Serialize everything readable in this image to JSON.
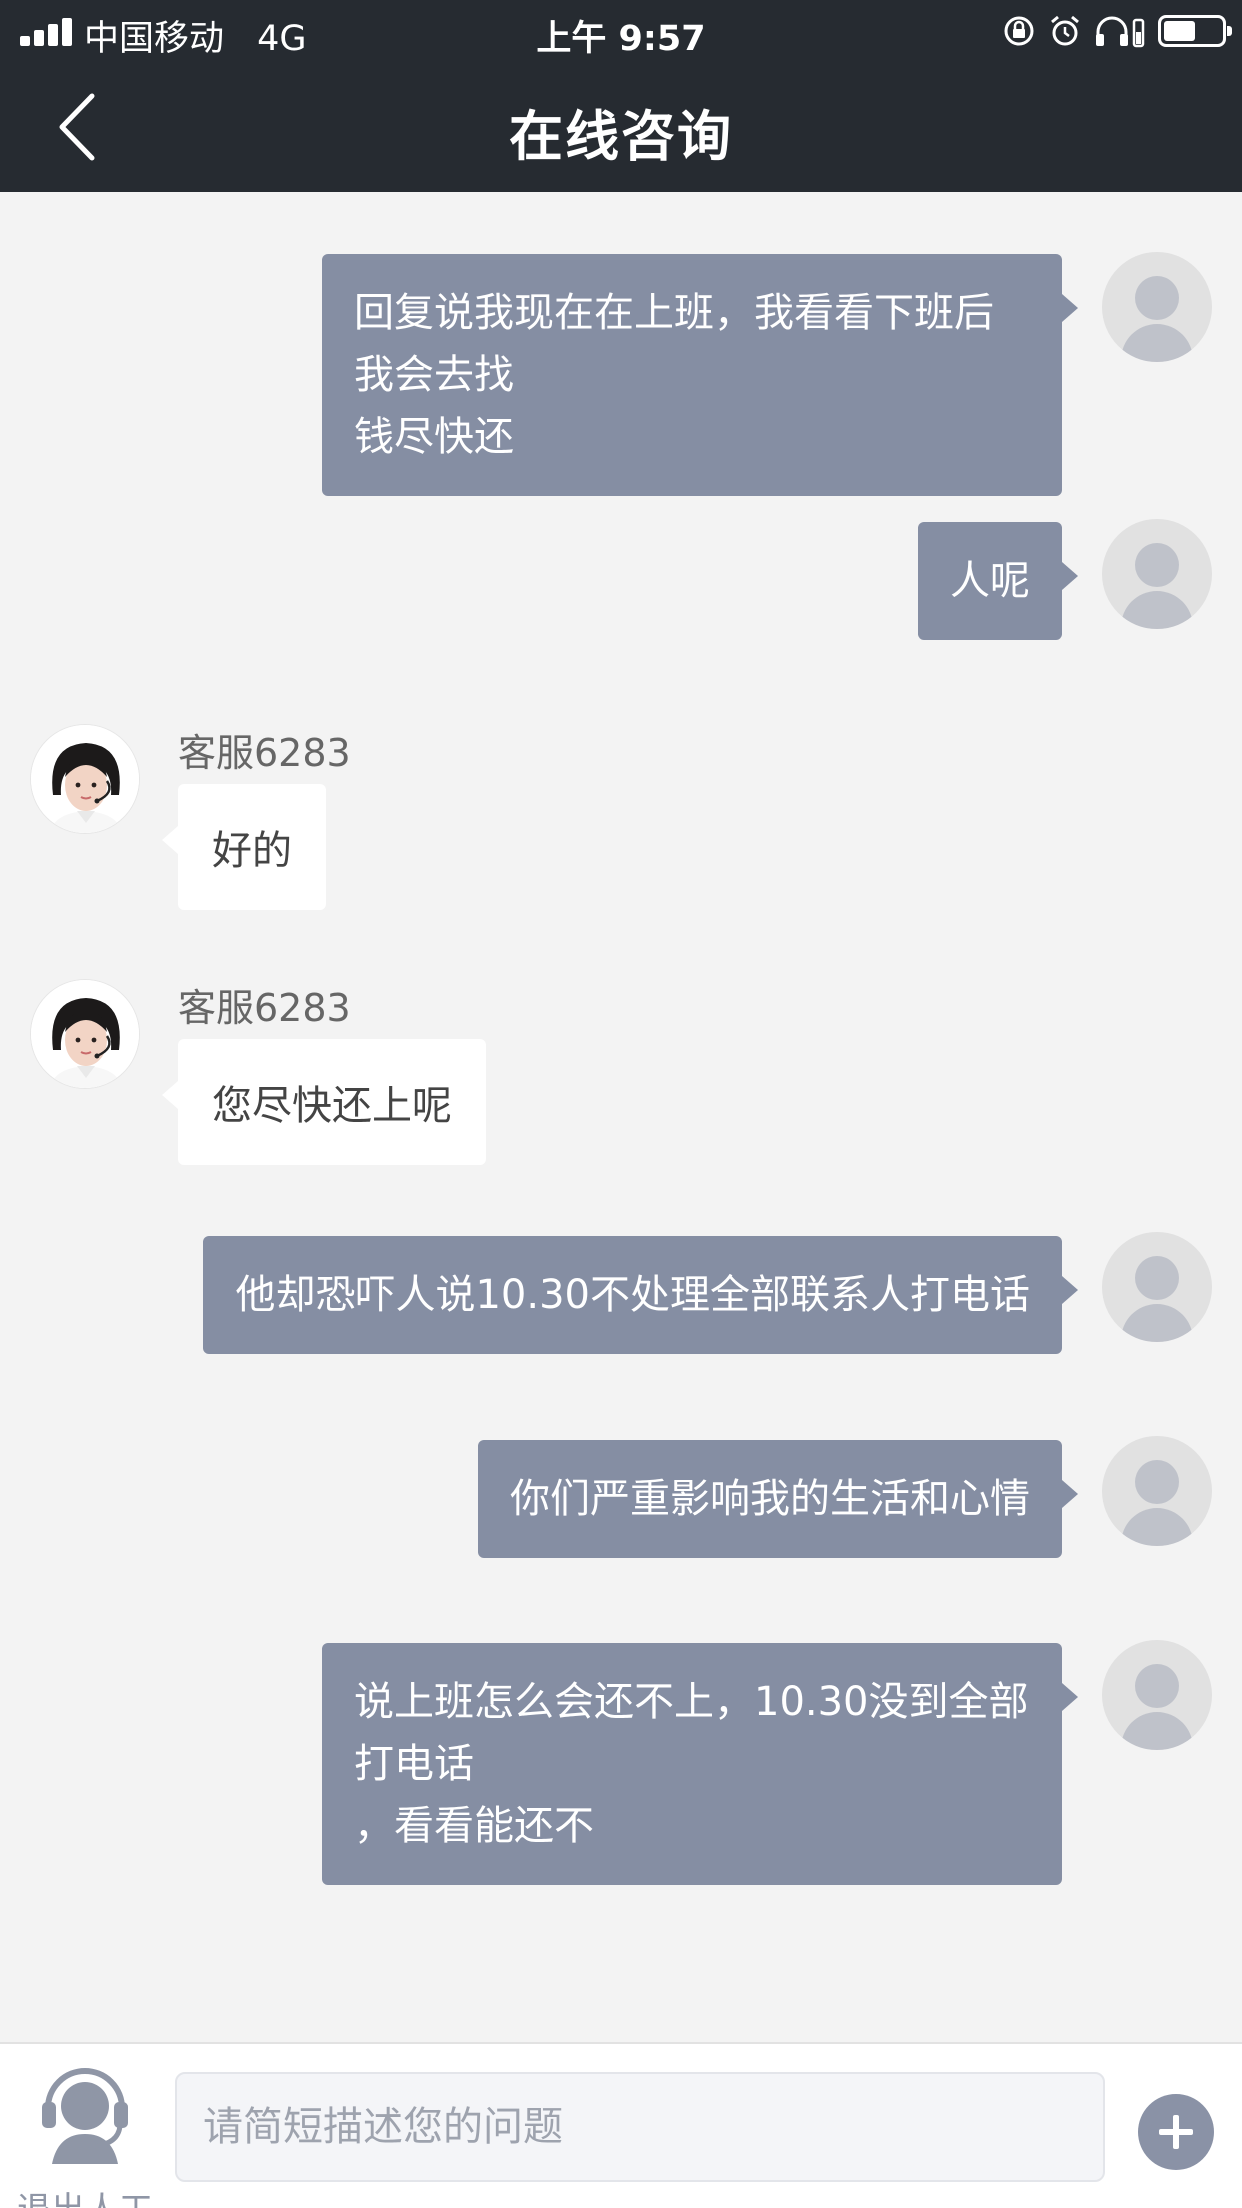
{
  "status_bar": {
    "carrier": "中国移动",
    "network": "4G",
    "time": "上午 9:57",
    "battery_level": 0.55,
    "icons": [
      "orientation-lock-icon",
      "alarm-icon",
      "headphones-icon",
      "battery-icon"
    ]
  },
  "nav": {
    "title": "在线咨询",
    "back_icon": "chevron-left-icon"
  },
  "messages": [
    {
      "side": "user",
      "text": "回复说我现在在上班，我看看下班后我会去找\n钱尽快还"
    },
    {
      "side": "user",
      "text": "人呢"
    },
    {
      "side": "agent",
      "name": "客服6283",
      "text": "好的"
    },
    {
      "side": "agent",
      "name": "客服6283",
      "text": "您尽快还上呢"
    },
    {
      "side": "user",
      "text": "他却恐吓人说10.30不处理全部联系人打电话"
    },
    {
      "side": "user",
      "text": "你们严重影响我的生活和心情"
    },
    {
      "side": "user",
      "text": "说上班怎么会还不上，10.30没到全部打电话\n，看看能还不"
    }
  ],
  "input_bar": {
    "exit_label": "退出人工",
    "placeholder": "请简短描述您的问题",
    "value": "",
    "add_icon": "plus-icon"
  },
  "colors": {
    "header_bg": "#262b31",
    "user_bubble": "#858ea3",
    "agent_bubble": "#ffffff",
    "chat_bg": "#f3f3f3"
  }
}
